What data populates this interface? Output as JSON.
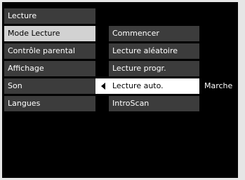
{
  "menu": {
    "items": [
      {
        "label": "Lecture"
      },
      {
        "label": "Mode Lecture"
      },
      {
        "label": "Contrôle parental"
      },
      {
        "label": "Affichage"
      },
      {
        "label": "Son"
      },
      {
        "label": "Langues"
      }
    ]
  },
  "submenu": {
    "items": [
      {
        "label": "Commencer"
      },
      {
        "label": "Lecture aléatoire"
      },
      {
        "label": "Lecture progr."
      },
      {
        "label": "Lecture auto."
      },
      {
        "label": "IntroScan"
      }
    ],
    "selected_value": "Marche"
  },
  "colors": {
    "background": "#000000",
    "item": "#3c3c3c",
    "highlight_main": "#d2d2d2",
    "highlight_sub": "#ffffff"
  },
  "icons": {
    "selected_arrow": "left-triangle-icon"
  }
}
